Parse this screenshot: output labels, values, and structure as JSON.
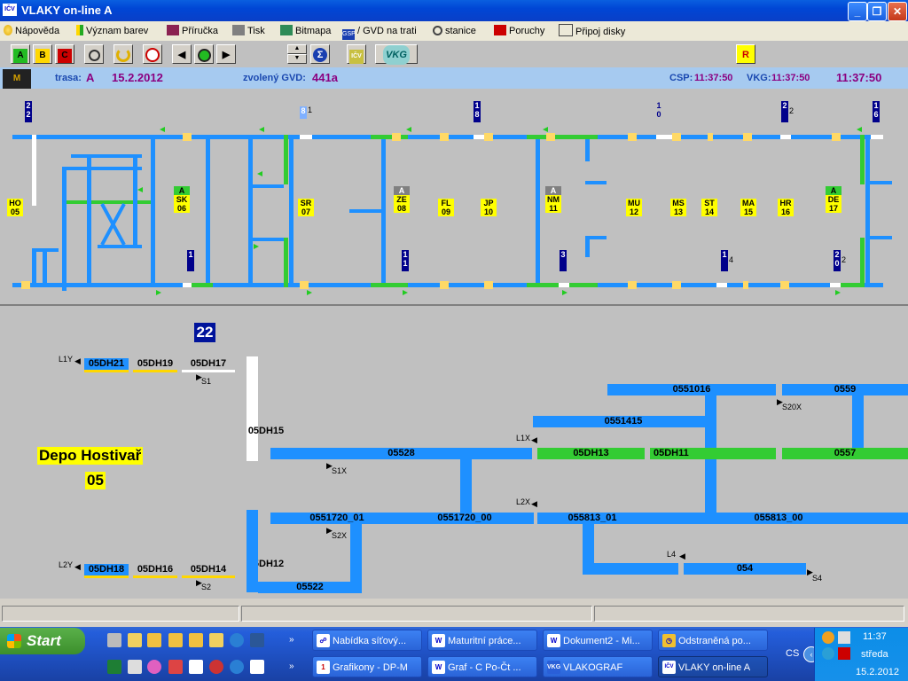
{
  "window": {
    "title": "VLAKY on-line A",
    "app_icon_text": "IČV",
    "minimize": "_",
    "maximize": "❐",
    "close": "✕"
  },
  "menu": [
    {
      "label": "Nápověda",
      "icon": "help-icon"
    },
    {
      "label": "Význam barev",
      "icon": "color-legend-icon"
    },
    {
      "label": "Příručka",
      "icon": "book-icon"
    },
    {
      "label": "Tisk",
      "icon": "printer-icon"
    },
    {
      "label": "Bitmapa",
      "icon": "bitmap-icon"
    },
    {
      "label": "/ GVD na trati",
      "icon": "gsp-icon"
    },
    {
      "label": "stanice",
      "icon": "station-search-icon"
    },
    {
      "label": "Poruchy",
      "icon": "phone-icon"
    },
    {
      "label": "Připoj disky",
      "icon": "network-disk-icon"
    }
  ],
  "toolbar": {
    "a": "A",
    "b": "B",
    "c": "C",
    "spin_value": "2",
    "ipv": "IČV",
    "vkg": "VKG",
    "r": "R"
  },
  "info": {
    "trasa_label": "trasa:",
    "trasa_value": "A",
    "date": "15.2.2012",
    "gvd_label": "zvolený GVD:",
    "gvd_value": "441a",
    "csp_label": "CSP:",
    "csp_time": "11:37:50",
    "vkg_label": "VKG:",
    "vkg_time": "11:37:50",
    "clock": "11:37:50",
    "logo_text": "M"
  },
  "stations": [
    {
      "code": "HO",
      "num": "05"
    },
    {
      "code": "SK",
      "num": "06",
      "flag": "A"
    },
    {
      "code": "SR",
      "num": "07"
    },
    {
      "code": "ZE",
      "num": "08",
      "flag": "A"
    },
    {
      "code": "FL",
      "num": "09"
    },
    {
      "code": "JP",
      "num": "10"
    },
    {
      "code": "NM",
      "num": "11",
      "flag": "A"
    },
    {
      "code": "MU",
      "num": "12"
    },
    {
      "code": "MS",
      "num": "13"
    },
    {
      "code": "ST",
      "num": "14"
    },
    {
      "code": "MA",
      "num": "15"
    },
    {
      "code": "HR",
      "num": "16"
    },
    {
      "code": "DE",
      "num": "17",
      "flag": "A"
    }
  ],
  "train_numbers_top": [
    {
      "digits": "2 2"
    },
    {
      "digits": "8",
      "sup": "1"
    },
    {
      "digits": "1 8"
    },
    {
      "digits": "1 0"
    },
    {
      "digits": "2",
      "sup": "2"
    },
    {
      "digits": "1 6"
    }
  ],
  "train_numbers_bottom": [
    {
      "digits": "1"
    },
    {
      "digits": "1 1"
    },
    {
      "digits": "3"
    },
    {
      "digits": "1",
      "sup": "4"
    },
    {
      "digits": "2 0",
      "sup": "2"
    }
  ],
  "depot": {
    "title": "Depo Hostivař",
    "number": "05",
    "big_number": "22",
    "segments": {
      "dh21": "05DH21",
      "dh19": "05DH19",
      "dh17": "05DH17",
      "dh15": "05DH15",
      "dh18": "05DH18",
      "dh16": "05DH16",
      "dh14": "05DH14",
      "dh12": "05DH12",
      "s522": "05522",
      "s528": "05528",
      "s551016": "0551016",
      "s559": "0559",
      "s551415": "0551415",
      "dh13": "05DH13",
      "dh11": "05DH11",
      "s557": "0557",
      "s551720_01": "0551720_01",
      "s551720_00": "0551720_00",
      "s55813_01": "055813_01",
      "s55813_00": "055813_00",
      "s054": "054"
    },
    "signals": {
      "l1y": "L1Y",
      "s1": "S1",
      "l2y": "L2Y",
      "s2": "S2",
      "s1x": "S1X",
      "l1x": "L1X",
      "l2x": "L2X",
      "s2x": "S2X",
      "s20x": "S20X",
      "l4": "L4",
      "s4": "S4"
    }
  },
  "taskbar": {
    "start": "Start",
    "tasks_row1": [
      {
        "label": "Nabídka síťový...",
        "icon": "network-icon"
      },
      {
        "label": "Maturitní práce...",
        "icon": "word-icon"
      },
      {
        "label": "Dokument2 - Mi...",
        "icon": "word-icon"
      },
      {
        "label": "Odstraněná po...",
        "icon": "clock-icon"
      }
    ],
    "tasks_row2": [
      {
        "label": "Grafikony - DP-M",
        "icon": "app-icon"
      },
      {
        "label": "Graf - C Po-Čt ...",
        "icon": "graph-icon"
      },
      {
        "label": "VLAKOGRAF",
        "icon": "vkg-icon"
      },
      {
        "label": "VLAKY on-line A",
        "icon": "icv-icon",
        "active": true
      }
    ],
    "lang": "CS",
    "time": "11:37",
    "day": "středa",
    "date": "15.2.2012"
  }
}
